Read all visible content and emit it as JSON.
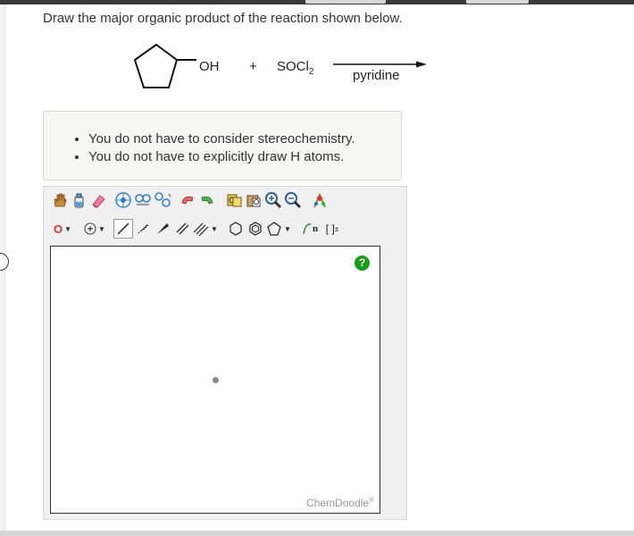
{
  "question": "Draw the major organic product of the reaction shown below.",
  "reaction": {
    "reactant_group": "OH",
    "plus": "+",
    "reagent": "SOCl",
    "reagent_sub": "2",
    "condition": "pyridine"
  },
  "instructions": [
    "You do not have to consider stereochemistry.",
    "You do not have to explicitly draw H atoms."
  ],
  "editor": {
    "element_selected": "O",
    "help_label": "?",
    "watermark": "ChemDoodle",
    "watermark_mark": "®",
    "bracket_label": "[ ]",
    "bracket_sup": "±",
    "repeat_label": "n"
  }
}
